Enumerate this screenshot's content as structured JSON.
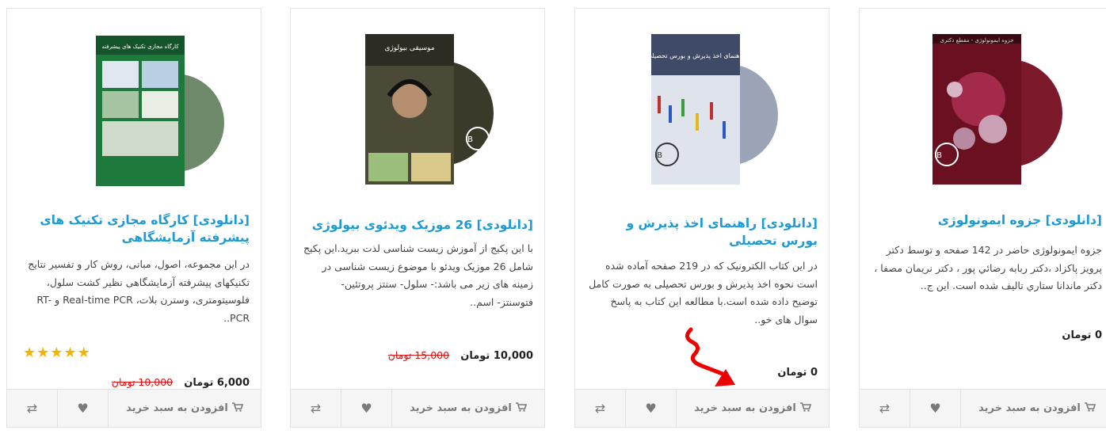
{
  "products": [
    {
      "title": "[دانلودی] جزوه ایمونولوژی",
      "description": "جزوه ایمونولوژی حاضر در 142 صفحه و توسط دکتر پرویز پاکزاد ،دکتر ربابه رضائي پور ، دکتر نریمان مصفا ، دکتر ماندانا ستاري تاليف شده است. این ج..",
      "price": "0 تومان",
      "old_price": "",
      "cart_label": "افزودن به سبد خرید",
      "cover_text": "جزوه ایمونولوژی - مقطع دکتری"
    },
    {
      "title": "[دانلودی] راهنمای اخذ پذیرش و بورس تحصیلی",
      "description": "در این کتاب الکترونیک که در 219 صفحه آماده شده است نحوه اخذ پذیرش و بورس تحصیلی به صورت کامل توضیح داده شده است.با مطالعه این کتاب به پاسخ سوال های خو..",
      "price": "0 تومان",
      "old_price": "",
      "cart_label": "افزودن به سبد خرید",
      "cover_text": "راهنمای اخذ پذیرش و بورس تحصیلی"
    },
    {
      "title": "[دانلودی] 26 موزیک ویدئوی بیولوژی",
      "description": "با این پکیج از آموزش زیست شناسی لذت ببرید.این پکیج شامل 26 موزیک ویدئو با موضوع زیست شناسی در زمینه های زیر می باشد:- سلول- سنتز پروتئین- فتوسنتز- اسم..",
      "price": "10,000 تومان",
      "old_price": "15,000 تومان",
      "cart_label": "افزودن به سبد خرید",
      "cover_text": "موسیقی بیولوژی"
    },
    {
      "title": "[دانلودی] کارگاه مجازی تکنیک های پیشرفته آزمایشگاهی",
      "description": "در این مجموعه، اصول، مبانی، روش کار و تفسیر نتایج تکنیکهای پیشرفته آزمایشگاهی نظیر کشت سلول، فلوسیتومتری، وسترن بلات، Real-time PCR و RT-PCR..",
      "price": "6,000 تومان",
      "old_price": "10,000 تومان",
      "rating": 5,
      "cart_label": "افزودن به سبد خرید",
      "cover_text": "کارگاه مجازی تکنیک های پیشرفته"
    }
  ],
  "icons": {
    "compare": "⇄",
    "wishlist": "♥",
    "cart": "cart",
    "star": "★"
  },
  "colors": {
    "title": "#1a9ad6",
    "old_price": "#dd1111",
    "star": "#f5b301",
    "annotation_arrow": "#ee0000"
  }
}
